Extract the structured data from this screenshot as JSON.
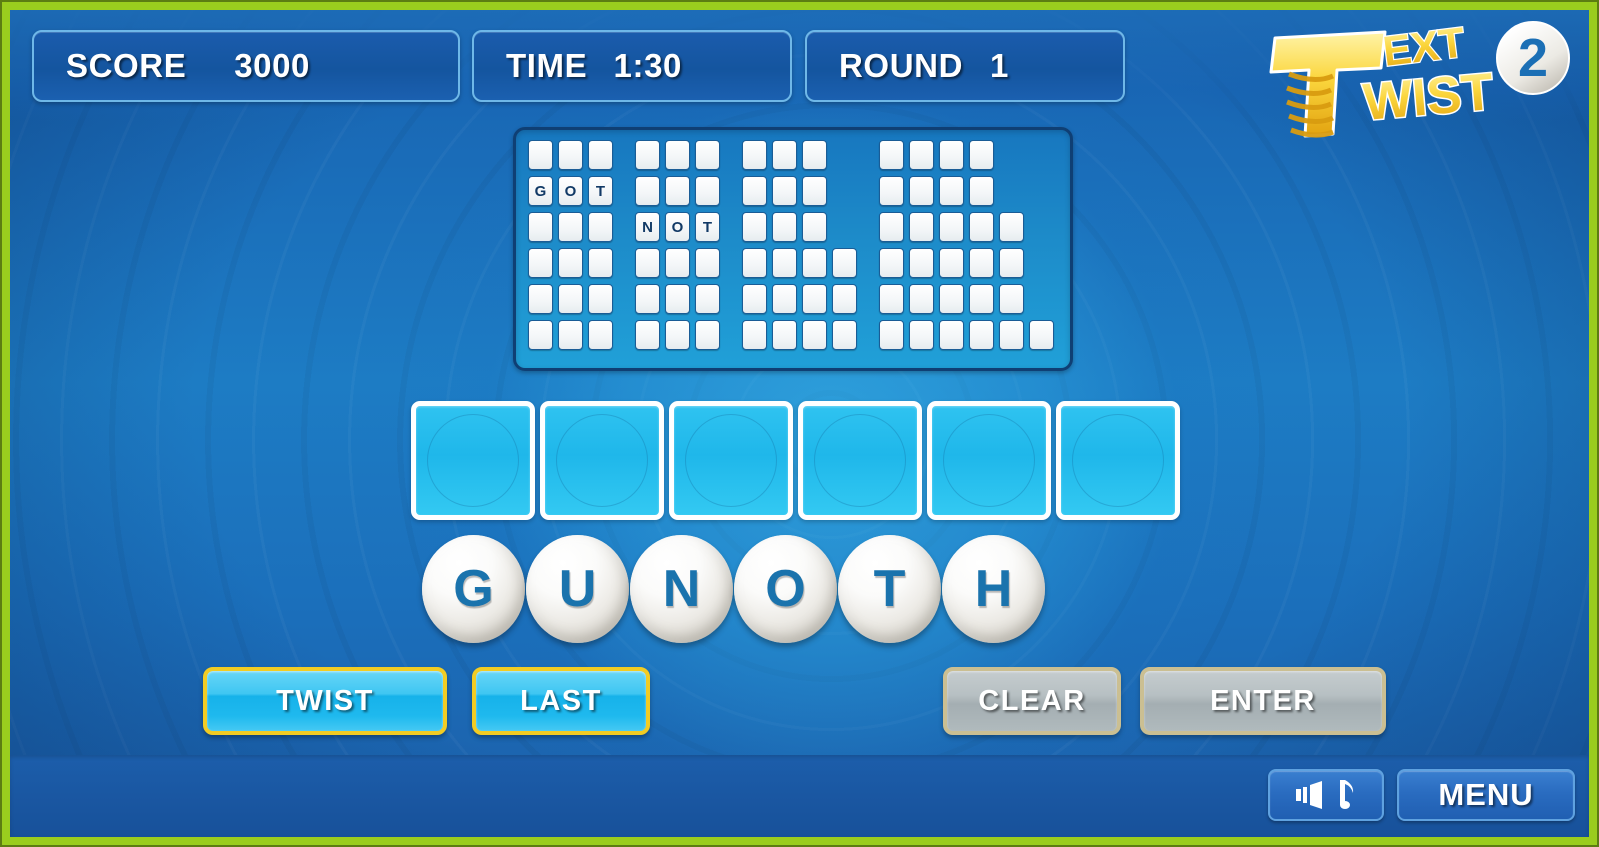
{
  "header": {
    "score": {
      "label": "SCORE",
      "value": "3000"
    },
    "time": {
      "label": "TIME",
      "value": "1:30"
    },
    "round": {
      "label": "ROUND",
      "value": "1"
    }
  },
  "logo": {
    "text_part1": "EXT",
    "text_part2": "WIST",
    "badge": "2",
    "letter_t": "T"
  },
  "word_grid": {
    "columns": [
      {
        "word_length": 3,
        "rows": [
          "",
          "GOT",
          "",
          "",
          "",
          ""
        ]
      },
      {
        "word_length": 3,
        "rows": [
          "",
          "",
          "NOT",
          "",
          "",
          ""
        ]
      },
      {
        "word_length": 3,
        "rows": [
          "",
          "",
          "",
          "",
          "",
          ""
        ],
        "row_lengths": [
          3,
          3,
          3,
          4,
          4,
          4
        ]
      },
      {
        "word_length": 4,
        "rows": [
          "",
          "",
          "",
          "",
          "",
          ""
        ],
        "row_lengths": [
          4,
          4,
          5,
          5,
          5,
          6
        ]
      }
    ]
  },
  "answer_slots": [
    "",
    "",
    "",
    "",
    "",
    ""
  ],
  "letters": [
    "G",
    "U",
    "N",
    "O",
    "T",
    "H"
  ],
  "buttons": {
    "twist": {
      "label": "TWIST",
      "enabled": true
    },
    "last": {
      "label": "LAST",
      "enabled": true
    },
    "clear": {
      "label": "CLEAR",
      "enabled": false
    },
    "enter": {
      "label": "ENTER",
      "enabled": false
    }
  },
  "bottom": {
    "sound_icon": "speaker-music-icon",
    "menu_label": "MENU"
  },
  "colors": {
    "frame_green": "#9acd1e",
    "panel_blue": "#1b5cad",
    "accent_yellow": "#f2cc23",
    "tile_white": "#ffffff",
    "letter_blue": "#1a73ad",
    "slot_cyan": "#1fb7ea"
  }
}
